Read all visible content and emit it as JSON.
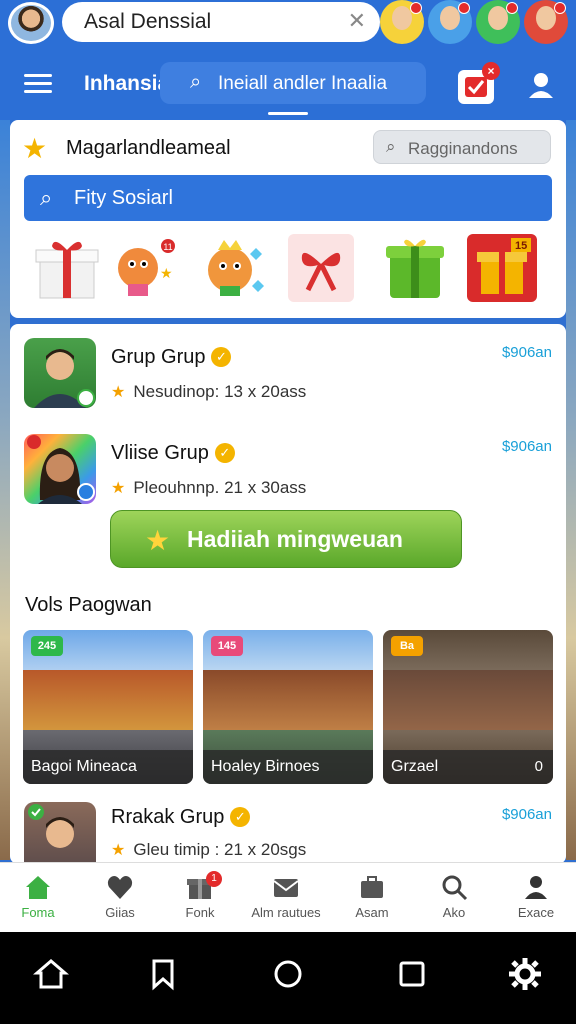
{
  "top_bar": {
    "search_value": "Asal Denssial",
    "clear_icon": "close-icon",
    "friend_count_badges": [
      "",
      "",
      "",
      ""
    ]
  },
  "header": {
    "title": "Inhansia",
    "search_text": "Ineiall andler Inaalia",
    "notification_badge": "×"
  },
  "promo": {
    "title": "Magarlandleameal",
    "search_placeholder": "Ragginandons",
    "bar_text": "Fity Sosiarl",
    "items": [
      "gift-box",
      "mascot-sparkle",
      "mascot-gem",
      "ribbon",
      "green-box",
      "red-gift"
    ],
    "red_gift_label": "15"
  },
  "groups": [
    {
      "name": "Grup Grup",
      "meta": "Nesudinop: 13 x 20ass",
      "price": "$906an"
    },
    {
      "name": "Vliise Grup",
      "meta": "Pleouhnnp. 21 x 30ass",
      "price": "$906an"
    },
    {
      "name": "Rrakak Grup",
      "meta": "Gleu timip : 21 x 20sgs",
      "price": "$906an"
    }
  ],
  "reward_button": "Hadiiah mingweuan",
  "section_title": "Vols Paogwan",
  "scenes": [
    {
      "caption": "Bagoi Mineaca",
      "tag": "245",
      "count": ""
    },
    {
      "caption": "Hoaley Birnoes",
      "tag": "145",
      "count": ""
    },
    {
      "caption": "Grzael",
      "tag": "Ba",
      "count": "0"
    }
  ],
  "nav": [
    {
      "label": "Foma",
      "icon": "home-icon",
      "active": true
    },
    {
      "label": "Giias",
      "icon": "heart-icon"
    },
    {
      "label": "Fonk",
      "icon": "gift-icon",
      "badge": "1"
    },
    {
      "label": "Alm rautues",
      "icon": "mail-icon"
    },
    {
      "label": "Asam",
      "icon": "briefcase-icon"
    },
    {
      "label": "Ako",
      "icon": "search-icon"
    },
    {
      "label": "Exace",
      "icon": "profile-icon"
    }
  ],
  "colors": {
    "header_blue": "#2c6fd6",
    "active_green": "#3cb043",
    "price_blue": "#1aa0d8",
    "reward_green": "#5aa82a"
  }
}
